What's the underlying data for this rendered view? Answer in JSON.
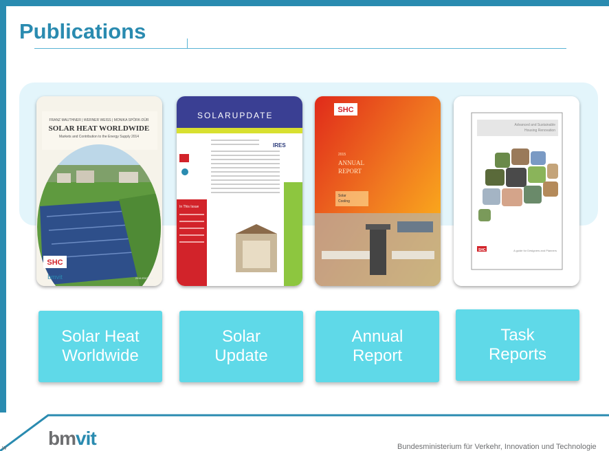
{
  "slide": {
    "title": "Publications",
    "accent_color": "#2a8bb0",
    "tile_color": "#5fd9e8"
  },
  "covers": [
    {
      "publisher": "FRANZ MAUTHNER | WERNER WEISS | MONIKA SPÖRK-DÜR",
      "title": "SOLAR HEAT WORLDWIDE",
      "subtitle": "Markets and Contribution to the Energy Supply 2014",
      "edition": "2016 EDITION",
      "logo_top": "SHC",
      "logo_bottom": "bmvit"
    },
    {
      "title": "SOLARUPDATE",
      "sidebar_heading": "In This Issue",
      "badge": "IRES"
    },
    {
      "logo": "SHC",
      "year": "2015",
      "label_1": "ANNUAL",
      "label_2": "REPORT",
      "feature_1": "Solar",
      "feature_2": "Cooling"
    },
    {
      "title_1": "Advanced and Sustainable",
      "title_2": "Housing Renovation",
      "logo": "SHC",
      "footer": "A guide for Designers and Planners"
    }
  ],
  "tiles": [
    {
      "line1": "Solar Heat",
      "line2": "Worldwide"
    },
    {
      "line1": "Solar",
      "line2": "Update"
    },
    {
      "line1": "Annual",
      "line2": "Report"
    },
    {
      "line1": "Task",
      "line2": "Reports"
    }
  ],
  "footer": {
    "logo_part1": "bm",
    "logo_part2": "vit",
    "ministry": "Bundesministerium für Verkehr, Innovation und Technologie",
    "corner": "w"
  }
}
